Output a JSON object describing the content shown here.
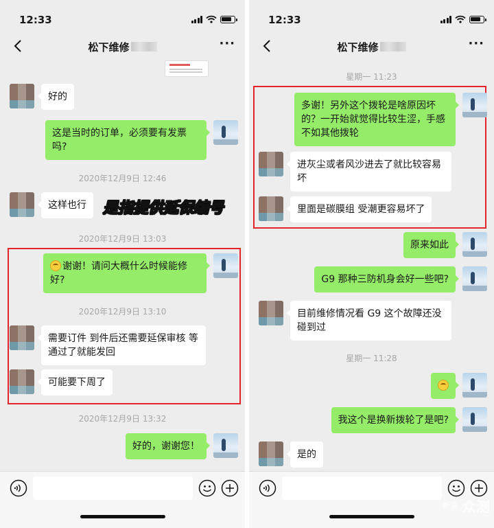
{
  "status": {
    "time": "12:33"
  },
  "chat": {
    "title": "松下维修"
  },
  "left": {
    "messages": [
      {
        "text": "好的"
      },
      {
        "text": "这是当时的订单，必须要有发票吗?"
      },
      {
        "text": "这样也行"
      },
      {
        "text": "谢谢！请问大概什么时候能修好?"
      },
      {
        "text": "需要订件 到件后还需要延保审核 等通过了就能发回"
      },
      {
        "text": "可能要下周了"
      },
      {
        "text": "好的，谢谢您！"
      }
    ],
    "timestamps": [
      "2020年12月9日 12:46",
      "2020年12月9日 13:03",
      "2020年12月9日 13:10",
      "2020年12月9日 13:32"
    ],
    "annotation": "是指提供延保编号"
  },
  "right": {
    "messages": [
      {
        "text": "多谢！另外这个拨轮是啥原因坏的？一开始就觉得比较生涩，手感不如其他拨轮"
      },
      {
        "text": "进灰尘或者风沙进去了就比较容易坏"
      },
      {
        "text": "里面是碳膜组 受潮更容易坏了"
      },
      {
        "text": "原来如此"
      },
      {
        "text": "G9 那种三防机身会好一些吧?"
      },
      {
        "text": "目前维修情况看 G9 这个故障还没碰到过"
      },
      {
        "text": ""
      },
      {
        "text": "我这个是换新拨轮了是吧?"
      },
      {
        "text": "是的"
      }
    ],
    "timestamps": [
      "星期一 11:23",
      "星期一 11:28"
    ]
  },
  "watermark": {
    "logo": "新浪",
    "text": "众测"
  },
  "colors": {
    "self_bubble": "#95ec69",
    "peer_bubble": "#ffffff",
    "highlight": "#e5232c",
    "background": "#ededed"
  },
  "icons": [
    "back-icon",
    "more-icon",
    "voice-icon",
    "emoji-icon",
    "plus-icon",
    "signal-icon",
    "wifi-icon",
    "battery-icon"
  ]
}
